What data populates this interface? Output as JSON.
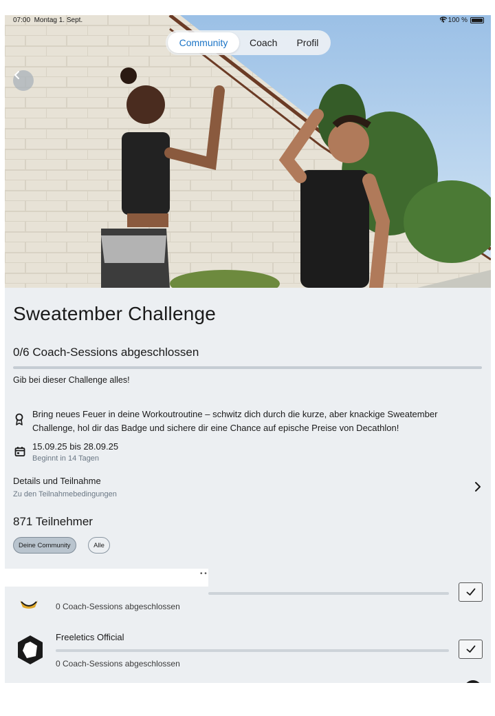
{
  "status_bar": {
    "time": "07:00",
    "date": "Montag 1. Sept.",
    "battery": "100 %"
  },
  "tabs": [
    {
      "label": "Community",
      "active": true
    },
    {
      "label": "Coach",
      "active": false
    },
    {
      "label": "Profil",
      "active": false
    }
  ],
  "challenge": {
    "title": "Sweatember Challenge",
    "progress_label": "0/6 Coach-Sessions abgeschlossen",
    "progress_fraction": 0,
    "tagline": "Gib bei dieser Challenge alles!",
    "description": "Bring neues Feuer in deine Workoutroutine – schwitz dich durch die kurze, aber knackige Sweatember Challenge, hol dir das Badge und sichere dir eine Chance auf epische Preise von Decathlon!",
    "dates": "15.09.25 bis 28.09.25",
    "dates_sub": "Beginnt in 14 Tagen"
  },
  "details": {
    "title": "Details und Teilnahme",
    "subtitle": "Zu den Teilnahmebedingungen"
  },
  "participants": {
    "count_label": "871 Teilnehmer",
    "filters": [
      {
        "label": "Deine Community",
        "active": true
      },
      {
        "label": "Alle",
        "active": false
      }
    ],
    "list": [
      {
        "name": "",
        "sessions": "0 Coach-Sessions abgeschlossen",
        "progress_fraction": 0
      },
      {
        "name": "Freeletics Official",
        "sessions": "0 Coach-Sessions abgeschlossen",
        "progress_fraction": 0
      }
    ]
  },
  "colors": {
    "accent": "#1b74c6",
    "background": "#eceff2"
  },
  "icons": {
    "back": "chevron-left-icon",
    "badge": "award-icon",
    "calendar": "calendar-icon",
    "details": "chevron-right-icon",
    "check": "checkmark-icon"
  }
}
